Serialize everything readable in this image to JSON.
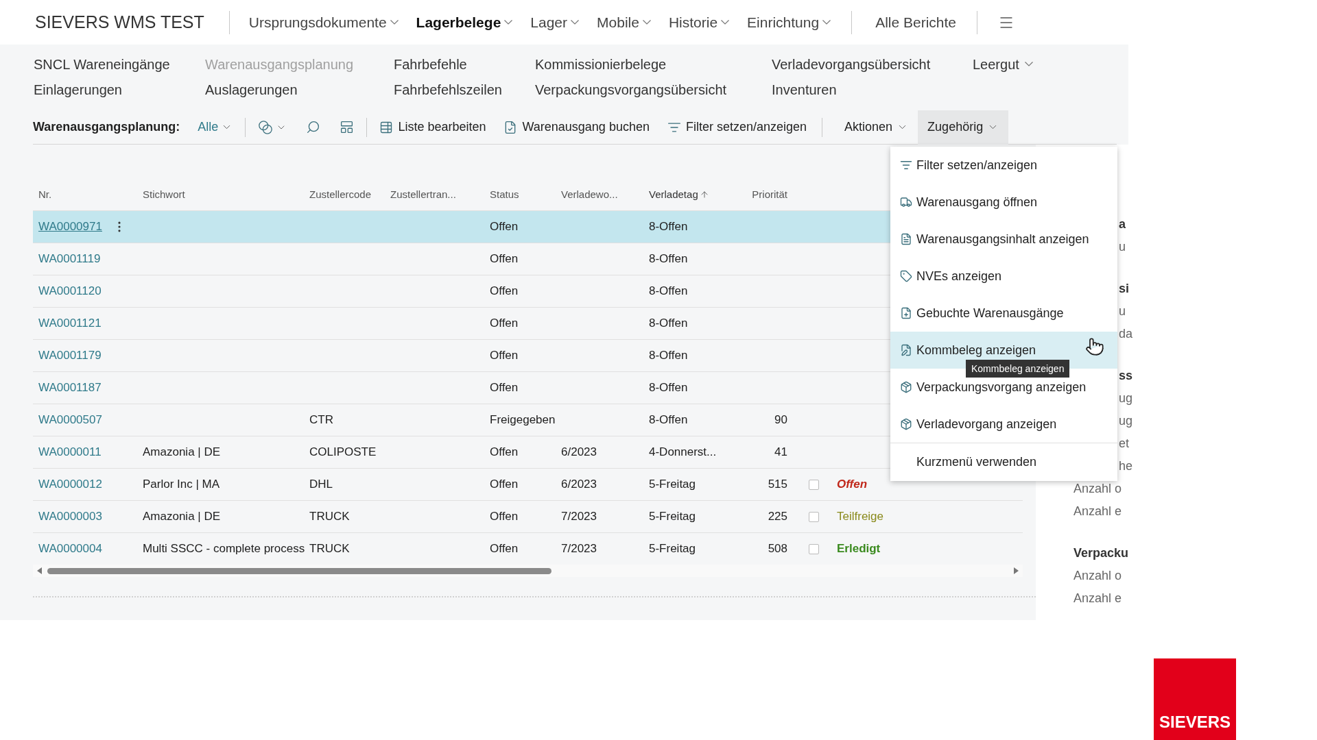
{
  "app_title": "SIEVERS WMS TEST",
  "nav": [
    {
      "label": "Ursprungsdokumente",
      "selected": false,
      "has_menu": true
    },
    {
      "label": "Lagerbelege",
      "selected": true,
      "has_menu": true
    },
    {
      "label": "Lager",
      "selected": false,
      "has_menu": true
    },
    {
      "label": "Mobile",
      "selected": false,
      "has_menu": true
    },
    {
      "label": "Historie",
      "selected": false,
      "has_menu": true
    },
    {
      "label": "Einrichtung",
      "selected": false,
      "has_menu": true
    }
  ],
  "reports_link": "Alle Berichte",
  "subnav": [
    [
      {
        "label": "SNCL Wareneingänge",
        "selected": false
      },
      {
        "label": "Einlagerungen",
        "selected": false
      }
    ],
    [
      {
        "label": "Warenausgangsplanung",
        "selected": true
      },
      {
        "label": "Auslagerungen",
        "selected": false
      }
    ],
    [
      {
        "label": "Fahrbefehle",
        "selected": false
      },
      {
        "label": "Fahrbefehlszeilen",
        "selected": false
      }
    ],
    [
      {
        "label": "Kommissionierbelege",
        "selected": false
      },
      {
        "label": "Verpackungsvorgangsübersicht",
        "selected": false
      }
    ],
    [
      {
        "label": "Verladevorgangsübersicht",
        "selected": false
      },
      {
        "label": "Inventuren",
        "selected": false
      }
    ],
    [
      {
        "label": "Leergut",
        "selected": false,
        "has_menu": true
      }
    ]
  ],
  "toolbar": {
    "label": "Warenausgangsplanung:",
    "view": "Alle",
    "actions": [
      {
        "label": "Liste bearbeiten",
        "kind": "table"
      },
      {
        "label": "Warenausgang buchen",
        "kind": "document"
      },
      {
        "label": "Filter setzen/anzeigen",
        "kind": "filter"
      }
    ],
    "menus": [
      {
        "label": "Aktionen",
        "selected": false
      },
      {
        "label": "Zugehörig",
        "selected": true
      }
    ]
  },
  "table": {
    "columns": [
      {
        "label": "Nr.",
        "sorted": false
      },
      {
        "label": "Stichwort",
        "sorted": false
      },
      {
        "label": "Zustellercode",
        "sorted": false
      },
      {
        "label": "Zustellertran...",
        "sorted": false
      },
      {
        "label": "Status",
        "sorted": false
      },
      {
        "label": "Verladewo...",
        "sorted": false
      },
      {
        "label": "Verladetag",
        "sorted": true
      },
      {
        "label": "Priorität",
        "sorted": false
      }
    ],
    "rows": [
      {
        "nr": "WA0000971",
        "status": "Offen",
        "verladetag": "8-Offen",
        "selected": true
      },
      {
        "nr": "WA0001119",
        "status": "Offen",
        "verladetag": "8-Offen",
        "selected": false
      },
      {
        "nr": "WA0001120",
        "status": "Offen",
        "verladetag": "8-Offen",
        "selected": false
      },
      {
        "nr": "WA0001121",
        "status": "Offen",
        "verladetag": "8-Offen",
        "selected": false
      },
      {
        "nr": "WA0001179",
        "status": "Offen",
        "verladetag": "8-Offen",
        "selected": false
      },
      {
        "nr": "WA0001187",
        "status": "Offen",
        "verladetag": "8-Offen",
        "selected": false
      },
      {
        "nr": "WA0000507",
        "code": "CTR",
        "status": "Freigegeben",
        "verladetag": "8-Offen",
        "prio": "90",
        "selected": false
      },
      {
        "nr": "WA0000011",
        "stichwort": "Amazonia | DE",
        "code": "COLIPOSTE",
        "status": "Offen",
        "woche": "6/2023",
        "verladetag": "4-Donnerst...",
        "prio": "41",
        "selected": false
      },
      {
        "nr": "WA0000012",
        "stichwort": "Parlor Inc | MA",
        "code": "DHL",
        "status": "Offen",
        "woche": "6/2023",
        "verladetag": "5-Freitag",
        "prio": "515",
        "checked": false,
        "state": {
          "text": "Offen",
          "color": "#c0281b",
          "kind": "bold_italic"
        },
        "selected": false
      },
      {
        "nr": "WA0000003",
        "stichwort": "Amazonia | DE",
        "code": "TRUCK",
        "status": "Offen",
        "woche": "7/2023",
        "verladetag": "5-Freitag",
        "prio": "225",
        "checked": false,
        "state": {
          "text": "Teilfreige",
          "color": "#8a8a1c",
          "kind": "normal"
        },
        "selected": false
      },
      {
        "nr": "WA0000004",
        "stichwort": "Multi SSCC - complete process",
        "code": "TRUCK",
        "status": "Offen",
        "woche": "7/2023",
        "verladetag": "5-Freitag",
        "prio": "508",
        "checked": false,
        "state": {
          "text": "Erledigt",
          "color": "#3a8a1e",
          "kind": "bold"
        },
        "selected": false
      }
    ]
  },
  "menu": {
    "items": [
      {
        "label": "Filter setzen/anzeigen",
        "kind": "filter",
        "selected": false
      },
      {
        "label": "Warenausgang öffnen",
        "kind": "truck",
        "selected": false
      },
      {
        "label": "Warenausgangsinhalt anzeigen",
        "kind": "list",
        "selected": false
      },
      {
        "label": "NVEs anzeigen",
        "kind": "label",
        "selected": false
      },
      {
        "label": "Gebuchte Warenausgänge",
        "kind": "posted",
        "selected": false
      },
      {
        "label": "Kommbeleg anzeigen",
        "kind": "edit",
        "selected": true
      },
      {
        "label": "Verpackungsvorgang anzeigen",
        "kind": "package",
        "selected": false
      },
      {
        "label": "Verladevorgang anzeigen",
        "kind": "package",
        "selected": false
      },
      {
        "label": "Kurzmenü verwenden",
        "kind": "plain",
        "selected": false
      }
    ],
    "tooltip": "Kommbeleg anzeigen"
  },
  "factbox": {
    "beside_menu": [
      {
        "text": "a",
        "kind": "heading"
      },
      {
        "text": "u",
        "kind": "line"
      },
      {
        "text": "si",
        "kind": "heading"
      },
      {
        "text": "u",
        "kind": "line"
      },
      {
        "text": "da",
        "kind": "line"
      },
      {
        "text": "ss",
        "kind": "heading"
      },
      {
        "text": "ug",
        "kind": "line"
      },
      {
        "text": "ug",
        "kind": "line"
      },
      {
        "text": "et",
        "kind": "line"
      },
      {
        "text": "he",
        "kind": "line"
      }
    ],
    "below_menu": [
      {
        "text": "Anzahl o",
        "kind": "line"
      },
      {
        "text": "Anzahl e",
        "kind": "line"
      },
      {
        "text": "Verpacku",
        "kind": "heading"
      },
      {
        "text": "Anzahl o",
        "kind": "line"
      },
      {
        "text": "Anzahl e",
        "kind": "line"
      }
    ]
  },
  "logo": "SIEVERS"
}
